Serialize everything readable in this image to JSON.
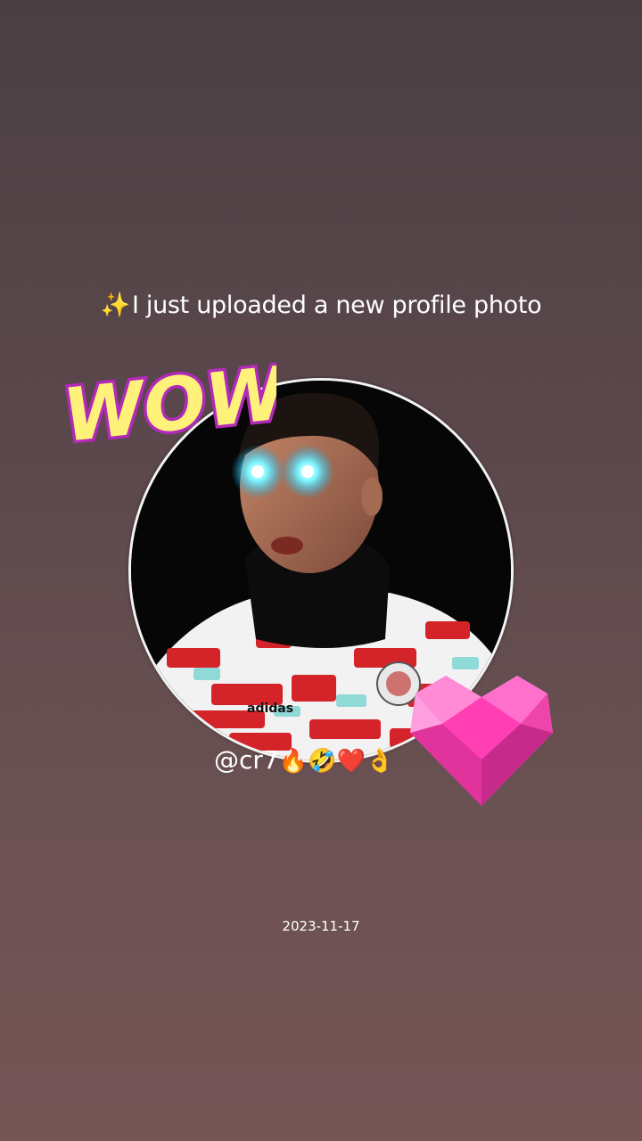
{
  "post": {
    "caption_icon": "sparkles-icon",
    "caption_sparkle": "✨",
    "caption_text": "I just uploaded a new profile photo",
    "sticker_wow": "WOW!",
    "sticker_heart": "pink-gem-heart-icon",
    "handle": "@cr7",
    "handle_emojis": "🔥🤣❤️👌",
    "date": "2023-11-17"
  },
  "colors": {
    "background_top": "#4a3f43",
    "background_bottom": "#765556",
    "text": "#ffffff",
    "ring": "#f3f3f3",
    "wow_fill": "#fff27a",
    "wow_outline": "#b12ab8",
    "heart": "#ff5cc4"
  }
}
